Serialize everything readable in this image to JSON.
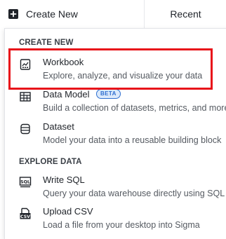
{
  "topbar": {
    "create_label": "Create New",
    "recent_label": "Recent"
  },
  "menu": {
    "section_create": "CREATE NEW",
    "section_explore": "EXPLORE DATA",
    "items": [
      {
        "title": "Workbook",
        "desc": "Explore, analyze, and visualize your data",
        "icon": "workbook-icon"
      },
      {
        "title": "Data Model",
        "badge": "BETA",
        "desc": "Build a collection of datasets, metrics, and more",
        "icon": "data-model-icon"
      },
      {
        "title": "Dataset",
        "desc": "Model your data into a reusable building block",
        "icon": "dataset-icon"
      },
      {
        "title": "Write SQL",
        "desc": "Query your data warehouse directly using SQL",
        "icon": "sql-icon",
        "icon_text": "SQL"
      },
      {
        "title": "Upload CSV",
        "desc": "Load a file from your desktop into Sigma",
        "icon": "csv-icon",
        "icon_text": "CSV"
      }
    ]
  },
  "colors": {
    "highlight": "#e8131a",
    "beta_border": "#2f6fd0",
    "beta_fill": "#dbe9fb"
  }
}
